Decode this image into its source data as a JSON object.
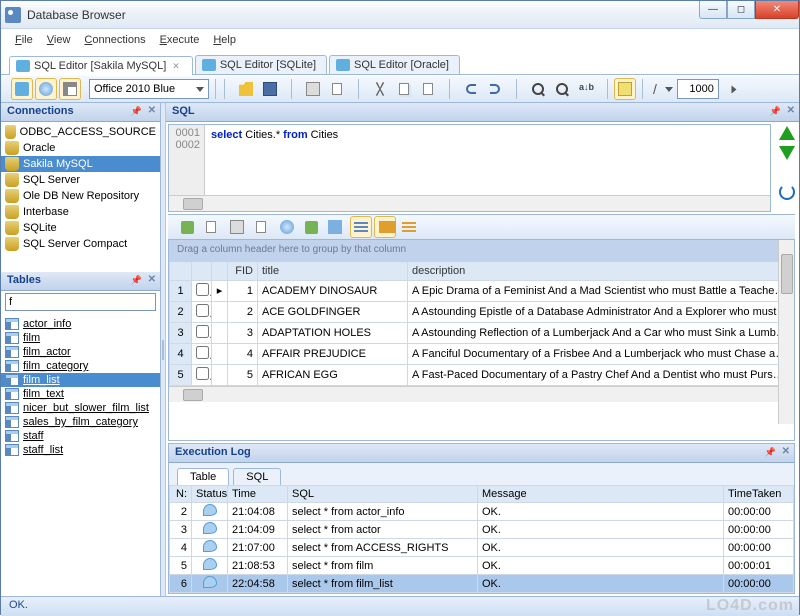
{
  "window": {
    "title": "Database Browser"
  },
  "menu": {
    "file": "File",
    "view": "View",
    "connections": "Connections",
    "execute": "Execute",
    "help": "Help"
  },
  "tabs": [
    {
      "label": "SQL Editor [Sakila MySQL]",
      "active": true,
      "closable": true
    },
    {
      "label": "SQL Editor [SQLite]",
      "active": false,
      "closable": false
    },
    {
      "label": "SQL Editor [Oracle]",
      "active": false,
      "closable": false
    }
  ],
  "toolbar": {
    "theme": "Office 2010 Blue",
    "limit": "1000"
  },
  "panels": {
    "connections": {
      "title": "Connections",
      "items": [
        "ODBC_ACCESS_SOURCE",
        "Oracle",
        "Sakila MySQL",
        "SQL Server",
        "Ole DB New Repository",
        "Interbase",
        "SQLite",
        "SQL Server Compact"
      ],
      "selected": 2
    },
    "tables": {
      "title": "Tables",
      "filter": "f",
      "items": [
        "actor_info",
        "film",
        "film_actor",
        "film_category",
        "film_list",
        "film_text",
        "nicer_but_slower_film_list",
        "sales_by_film_category",
        "staff",
        "staff_list"
      ],
      "selected": 4
    }
  },
  "sql": {
    "title": "SQL",
    "gutter": [
      "0001",
      "0002"
    ],
    "kw1": "select",
    "obj": " Cities.* ",
    "kw2": "from",
    "obj2": " Cities"
  },
  "grid": {
    "group_hint": "Drag a column header here to group by that column",
    "cols": {
      "fid": "FID",
      "title": "title",
      "desc": "description"
    },
    "rows": [
      {
        "n": "1",
        "fid": "1",
        "title": "ACADEMY DINOSAUR",
        "desc": "A Epic Drama of a Feminist And a Mad Scientist who must Battle a Teacher in Th"
      },
      {
        "n": "2",
        "fid": "2",
        "title": "ACE GOLDFINGER",
        "desc": "A Astounding Epistle of a Database Administrator And a Explorer who must Find"
      },
      {
        "n": "3",
        "fid": "3",
        "title": "ADAPTATION HOLES",
        "desc": "A Astounding Reflection of a Lumberjack And a Car who must Sink a Lumberjac"
      },
      {
        "n": "4",
        "fid": "4",
        "title": "AFFAIR PREJUDICE",
        "desc": "A Fanciful Documentary of a Frisbee And a Lumberjack who must Chase a Monk"
      },
      {
        "n": "5",
        "fid": "5",
        "title": "AFRICAN EGG",
        "desc": "A Fast-Paced Documentary of a Pastry Chef And a Dentist who must Pursue a"
      }
    ]
  },
  "execlog": {
    "title": "Execution Log",
    "tabs": {
      "table": "Table",
      "sql": "SQL"
    },
    "cols": {
      "n": "N:",
      "status": "Status",
      "time": "Time",
      "sql": "SQL",
      "message": "Message",
      "timetaken": "TimeTaken"
    },
    "rows": [
      {
        "n": "2",
        "time": "21:04:08",
        "sql": "select * from actor_info",
        "msg": "OK.",
        "tt": "00:00:00"
      },
      {
        "n": "3",
        "time": "21:04:09",
        "sql": "select * from actor",
        "msg": "OK.",
        "tt": "00:00:00"
      },
      {
        "n": "4",
        "time": "21:07:00",
        "sql": "select * from ACCESS_RIGHTS",
        "msg": "OK.",
        "tt": "00:00:00"
      },
      {
        "n": "5",
        "time": "21:08:53",
        "sql": "select * from film",
        "msg": "OK.",
        "tt": "00:00:01"
      },
      {
        "n": "6",
        "time": "22:04:58",
        "sql": "select * from film_list",
        "msg": "OK.",
        "tt": "00:00:00"
      }
    ],
    "selected": 4
  },
  "status": {
    "text": "OK."
  },
  "watermark": "LO4D.com"
}
